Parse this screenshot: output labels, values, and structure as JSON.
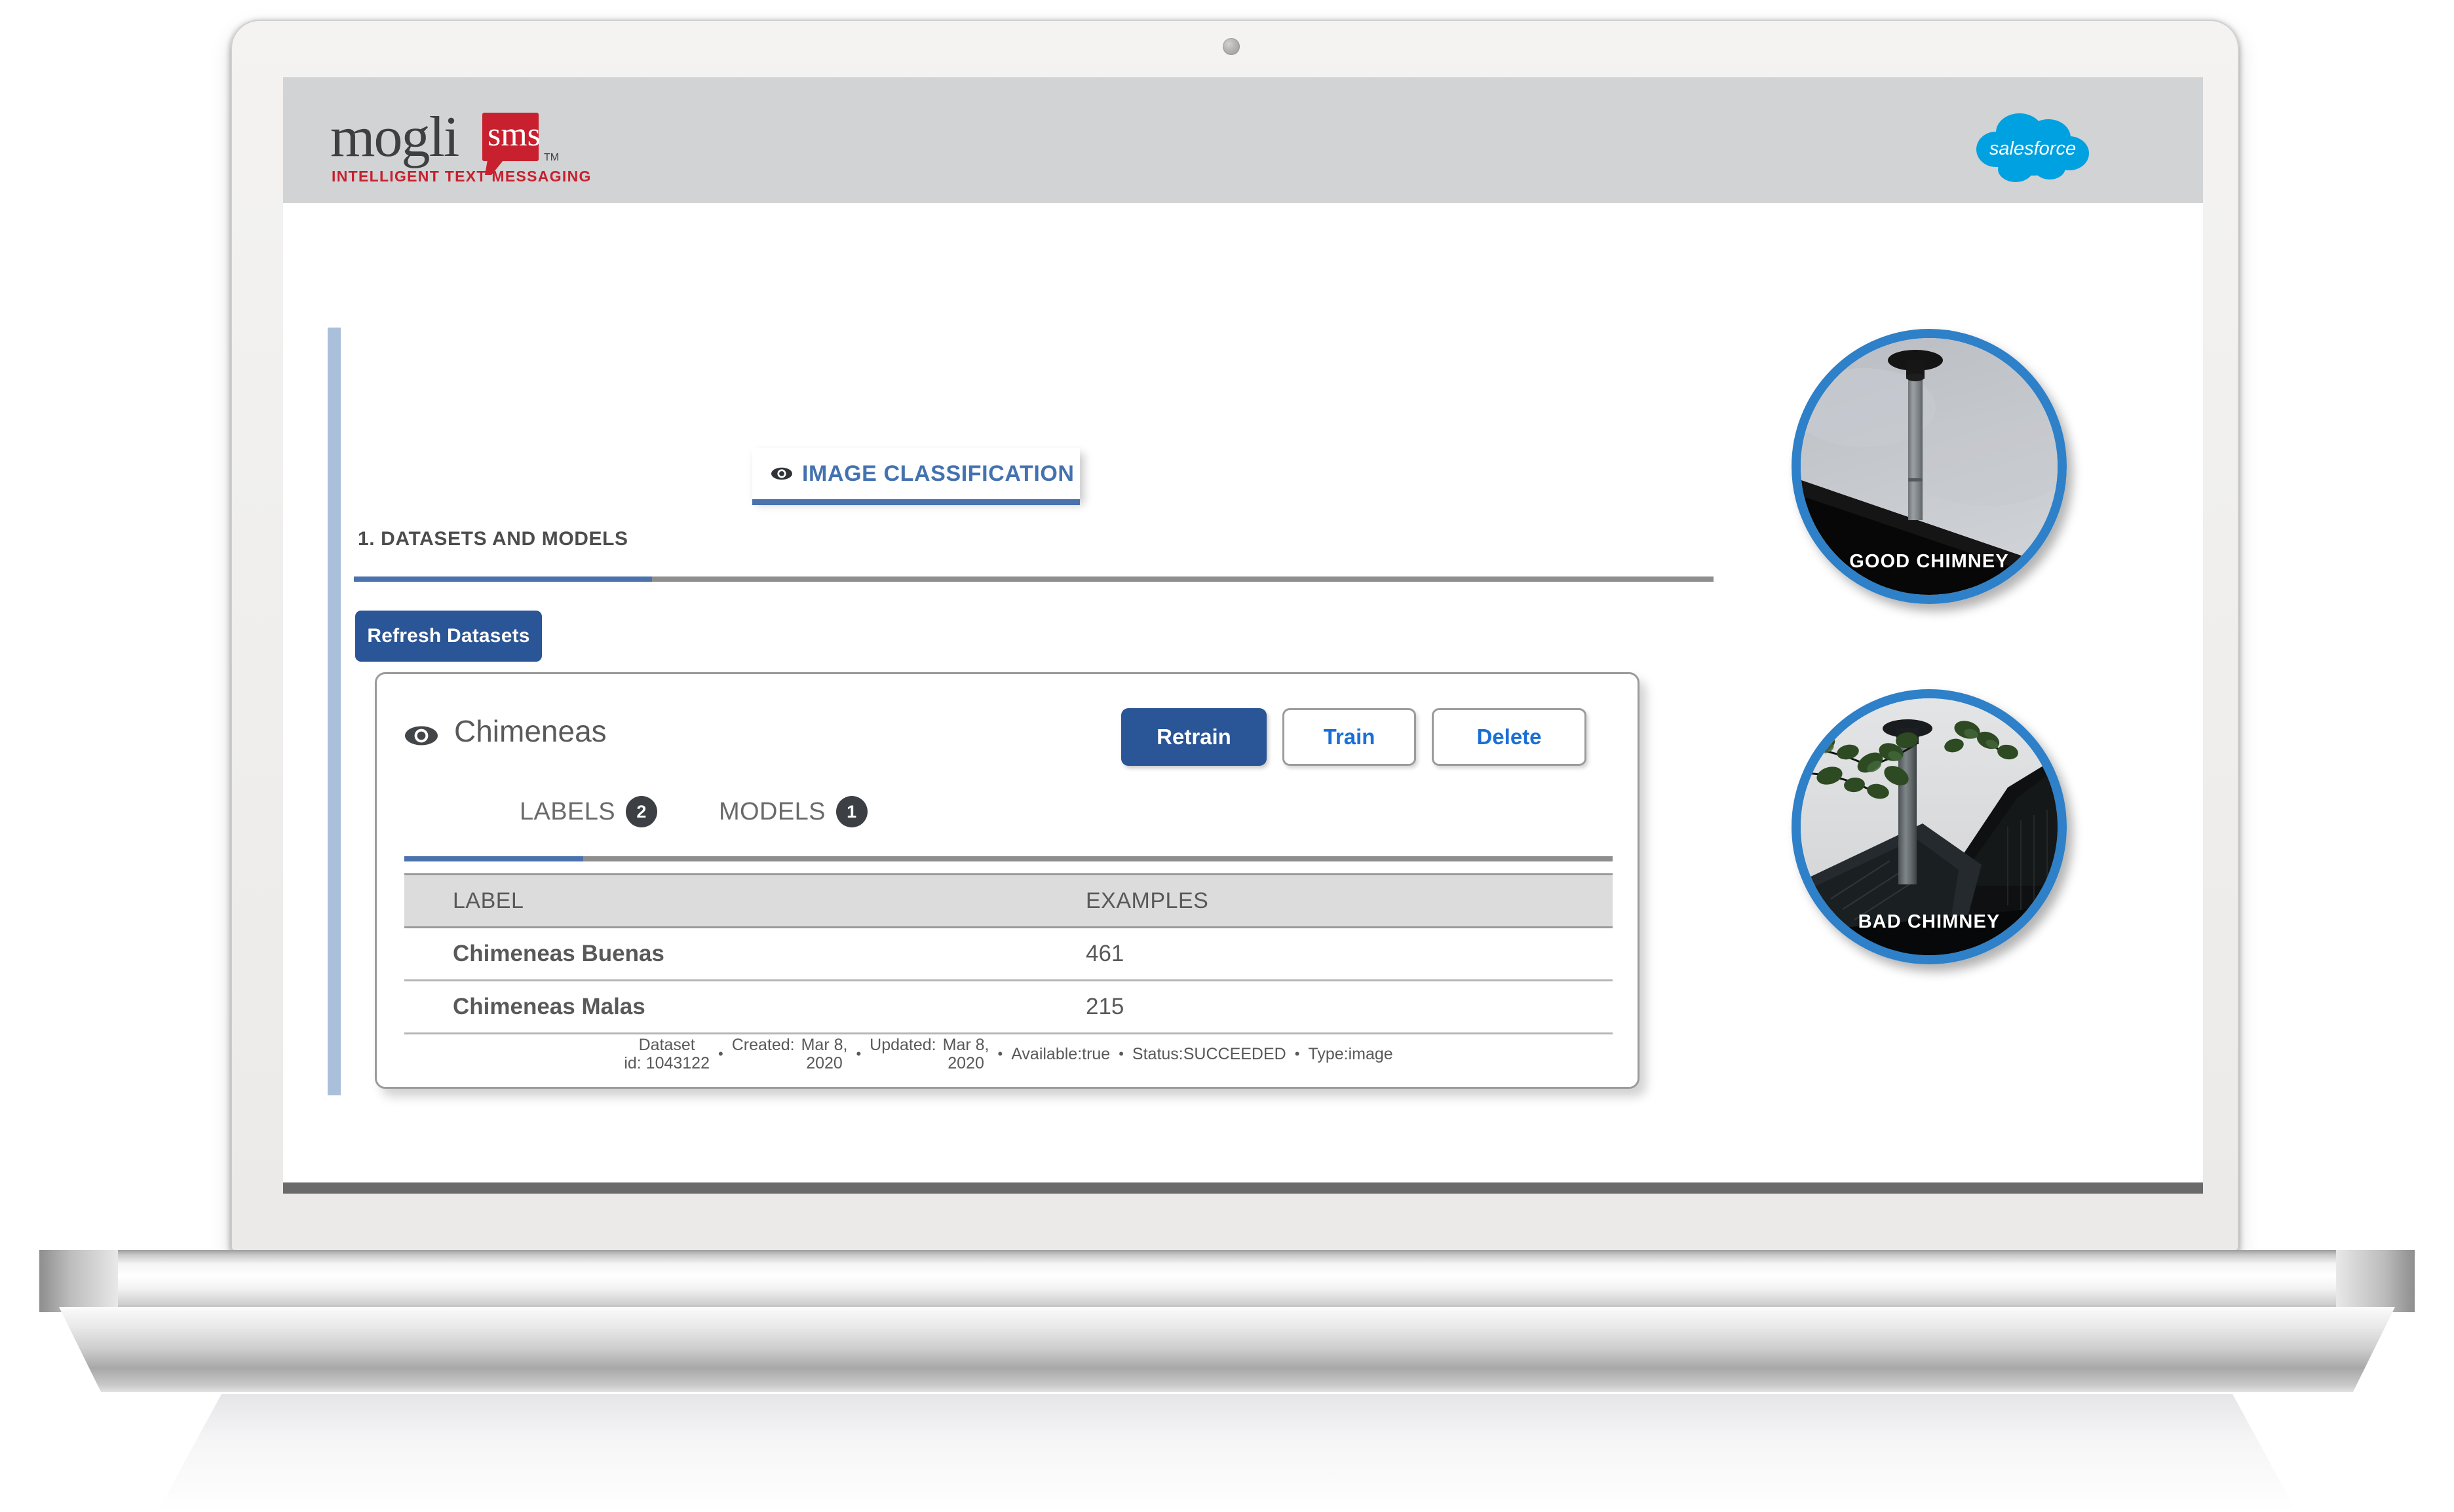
{
  "app_header": {
    "brand_name": "mogli",
    "brand_badge": "sms",
    "brand_tm": "TM",
    "tagline": "INTELLIGENT TEXT MESSAGING",
    "partner_logo_text": "salesforce",
    "brand_red": "#c8202e",
    "salesforce_blue": "#00a1e0",
    "header_bg": "#d1d3d4"
  },
  "tab": {
    "label": "IMAGE CLASSIFICATION",
    "icon": "eye-icon",
    "active": true,
    "accent": "#4472b0"
  },
  "section": {
    "heading": "1. DATASETS AND MODELS",
    "refresh_button": "Refresh Datasets",
    "button_blue": "#2a5596"
  },
  "dataset_card": {
    "icon": "eye-icon",
    "name": "Chimeneas",
    "actions": [
      {
        "label": "Retrain",
        "style": "primary"
      },
      {
        "label": "Train",
        "style": "outline"
      },
      {
        "label": "Delete",
        "style": "outline"
      }
    ],
    "tabs": [
      {
        "label": "LABELS",
        "count": "2",
        "active": true
      },
      {
        "label": "MODELS",
        "count": "1",
        "active": false
      }
    ],
    "table": {
      "columns": [
        "LABEL",
        "EXAMPLES"
      ],
      "rows": [
        {
          "label": "Chimeneas Buenas",
          "examples": "461"
        },
        {
          "label": "Chimeneas Malas",
          "examples": "215"
        }
      ]
    },
    "meta": {
      "dataset_id_line1": "Dataset",
      "dataset_id_line2": "id: 1043122",
      "created_label": "Created:",
      "created_line1": "Mar 8,",
      "created_line2": "2020",
      "updated_label": "Updated:",
      "updated_line1": "Mar 8,",
      "updated_line2": "2020",
      "available": "Available:true",
      "status": "Status:SUCCEEDED",
      "type": "Type:image",
      "bullet": "•"
    }
  },
  "photos": [
    {
      "caption": "GOOD  CHIMNEY",
      "ring_color": "#2e80c8"
    },
    {
      "caption": "BAD CHIMNEY",
      "ring_color": "#2e80c8"
    }
  ]
}
